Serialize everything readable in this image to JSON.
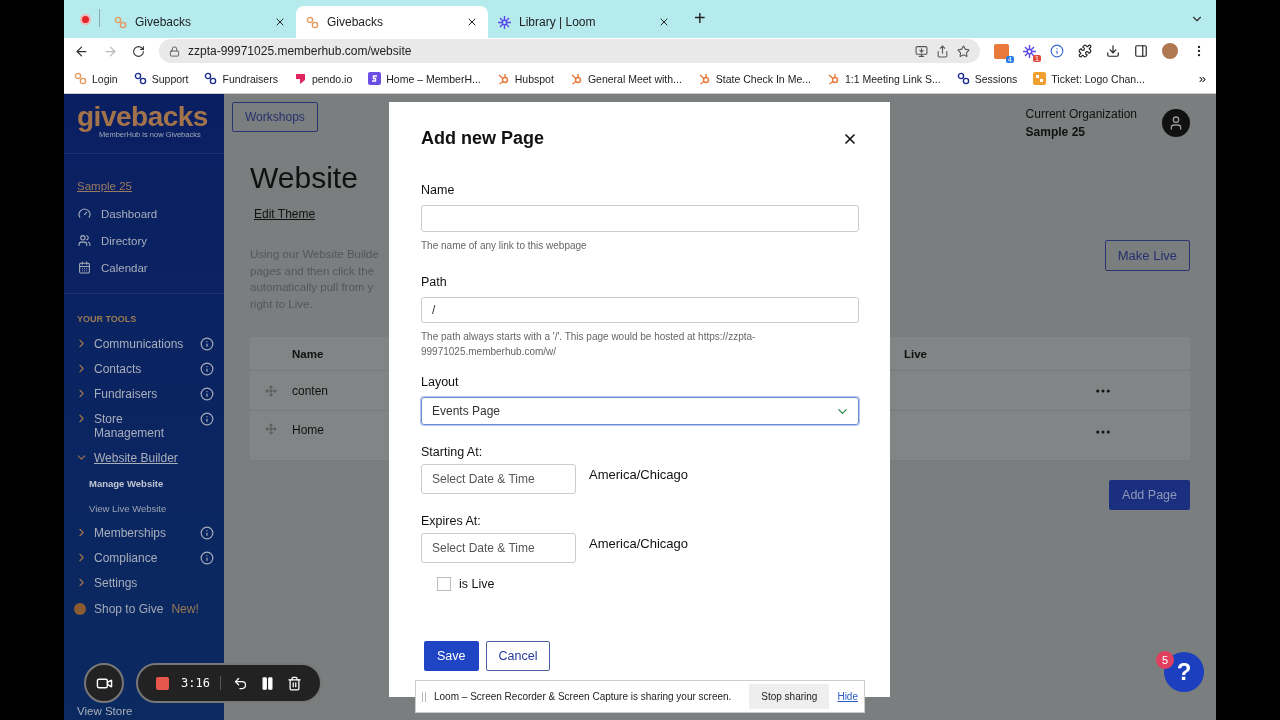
{
  "browser": {
    "tabs": [
      {
        "title": "Givebacks",
        "kind": "givebacks",
        "selected": false
      },
      {
        "title": "Givebacks",
        "kind": "givebacks",
        "selected": true
      },
      {
        "title": "Library | Loom",
        "kind": "loom",
        "selected": false
      }
    ],
    "new_tab": "+",
    "forward_disabled": true,
    "url": "zzpta-99971025.memberhub.com/website",
    "extension_badges": [
      "4",
      "1"
    ],
    "bookmarks": [
      {
        "label": "Login",
        "kind": "gb-orange"
      },
      {
        "label": "Support",
        "kind": "gb-blue"
      },
      {
        "label": "Fundraisers",
        "kind": "gb-blue"
      },
      {
        "label": "pendo.io",
        "kind": "pendo"
      },
      {
        "label": "Home – MemberH...",
        "kind": "s"
      },
      {
        "label": "Hubspot",
        "kind": "hubspot"
      },
      {
        "label": "General Meet with...",
        "kind": "hubspot"
      },
      {
        "label": "State Check In Me...",
        "kind": "hubspot"
      },
      {
        "label": "1:1 Meeting Link S...",
        "kind": "hubspot"
      },
      {
        "label": "Sessions",
        "kind": "gb-blue"
      },
      {
        "label": "Ticket: Logo Chan...",
        "kind": "ticket"
      }
    ],
    "bookmarks_more": "»"
  },
  "sidebar": {
    "logo": "givebacks",
    "tagline": "MemberHub is now Givebacks",
    "org_link": "Sample 25",
    "nav": [
      {
        "label": "Dashboard",
        "kind": "dashboard"
      },
      {
        "label": "Directory",
        "kind": "directory"
      },
      {
        "label": "Calendar",
        "kind": "calendar"
      }
    ],
    "tools_heading": "YOUR TOOLS",
    "tools": [
      {
        "label": "Communications",
        "info": true,
        "expanded": false
      },
      {
        "label": "Contacts",
        "info": true,
        "expanded": false
      },
      {
        "label": "Fundraisers",
        "info": true,
        "expanded": false
      },
      {
        "label": "Store Management",
        "info": true,
        "expanded": false
      },
      {
        "label": "Website Builder",
        "info": false,
        "expanded": true,
        "children": [
          {
            "label": "Manage Website",
            "selected": true
          },
          {
            "label": "View Live Website",
            "selected": false
          }
        ]
      },
      {
        "label": "Memberships",
        "info": true,
        "expanded": false
      },
      {
        "label": "Compliance",
        "info": true,
        "expanded": false
      },
      {
        "label": "Settings",
        "info": false,
        "expanded": false
      }
    ],
    "promo": {
      "label": "Shop to Give",
      "badge": "New!"
    },
    "footer_link": "View Store"
  },
  "main": {
    "workshops_button": "Workshops",
    "org": {
      "label": "Current Organization",
      "name": "Sample 25"
    },
    "title": "Website",
    "edit_theme": "Edit Theme",
    "description_lines": [
      "Using our Website Builde",
      "pages and then click the",
      "automatically pull from y",
      "right to Live."
    ],
    "make_live": "Make Live",
    "table": {
      "columns": [
        "Name",
        "Live"
      ],
      "rows": [
        {
          "name": "conten"
        },
        {
          "name": "Home"
        }
      ]
    },
    "add_page": "Add Page"
  },
  "modal": {
    "title": "Add new Page",
    "name": {
      "label": "Name",
      "hint": "The name of any link to this webpage"
    },
    "path": {
      "label": "Path",
      "value": "/",
      "hint": "The path always starts with a '/'. This page would be hosted at https://zzpta-99971025.memberhub.com/w/"
    },
    "layout": {
      "label": "Layout",
      "value": "Events Page",
      "focused": true
    },
    "starting": {
      "label": "Starting At:",
      "placeholder": "Select Date & Time",
      "timezone": "America/Chicago"
    },
    "expires": {
      "label": "Expires At:",
      "placeholder": "Select Date & Time",
      "timezone": "America/Chicago"
    },
    "is_live": {
      "label": "is Live",
      "checked": false
    },
    "save": "Save",
    "cancel": "Cancel"
  },
  "loom_controls": {
    "timer": "3:16"
  },
  "loom_banner": {
    "message": "Loom – Screen Recorder & Screen Capture is sharing your screen.",
    "stop": "Stop sharing",
    "hide": "Hide"
  },
  "help": {
    "label": "?",
    "badge": "5"
  }
}
